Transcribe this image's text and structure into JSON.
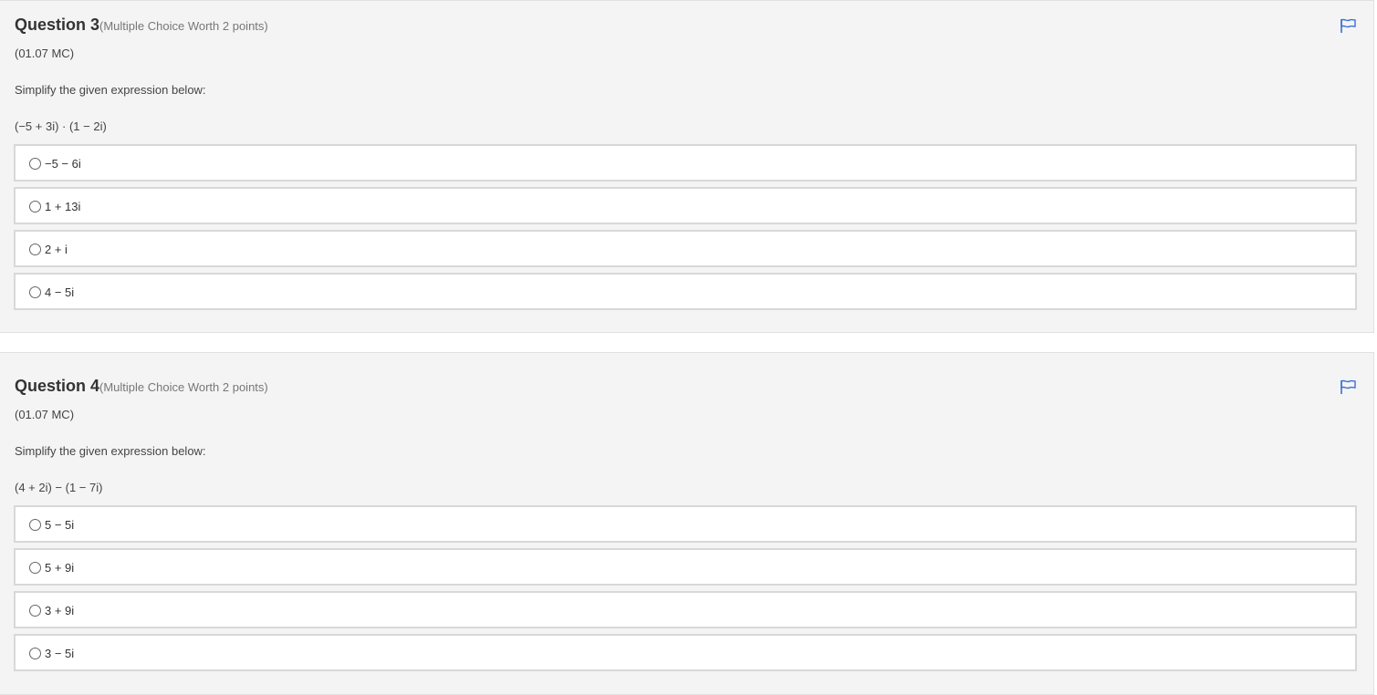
{
  "questions": [
    {
      "title": "Question 3",
      "meta": "(Multiple Choice Worth 2 points)",
      "code": "(01.07 MC)",
      "prompt": "Simplify the given expression below:",
      "expression": "(−5 + 3i) · (1 − 2i)",
      "options": [
        "−5 − 6i",
        "1 + 13i",
        "2 + i",
        "4 − 5i"
      ],
      "flag_icon": "flag-icon"
    },
    {
      "title": "Question 4",
      "meta": "(Multiple Choice Worth 2 points)",
      "code": "(01.07 MC)",
      "prompt": "Simplify the given expression below:",
      "expression": "(4 + 2i) − (1 − 7i)",
      "options": [
        "5 − 5i",
        "5 + 9i",
        "3 + 9i",
        "3 − 5i"
      ],
      "flag_icon": "flag-icon"
    }
  ],
  "colors": {
    "card_background": "#f4f4f4",
    "flag_accent": "#3a6fd8"
  }
}
